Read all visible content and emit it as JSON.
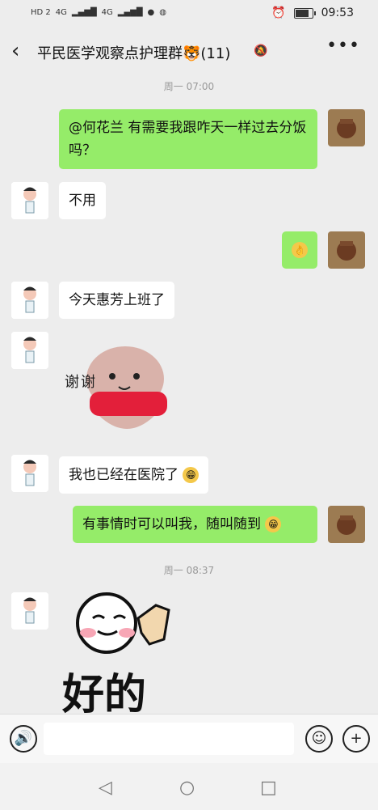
{
  "status": {
    "left": [
      "HD 2",
      "4G",
      "4G"
    ],
    "time": "09:53"
  },
  "header": {
    "title": "平民医学观察点护理群🐯(11)"
  },
  "timestamps": [
    "周一 07:00",
    "周一 08:37"
  ],
  "messages": {
    "m1": "@何花兰  有需要我跟咋天一样过去分饭吗？",
    "m2": "不用",
    "m3": "今天惠芳上班了",
    "m4": "我也已经在医院了",
    "m5": "有事情时可以叫我，随叫随到",
    "sticker_thanks": "谢谢",
    "sticker_ok": "好的"
  }
}
